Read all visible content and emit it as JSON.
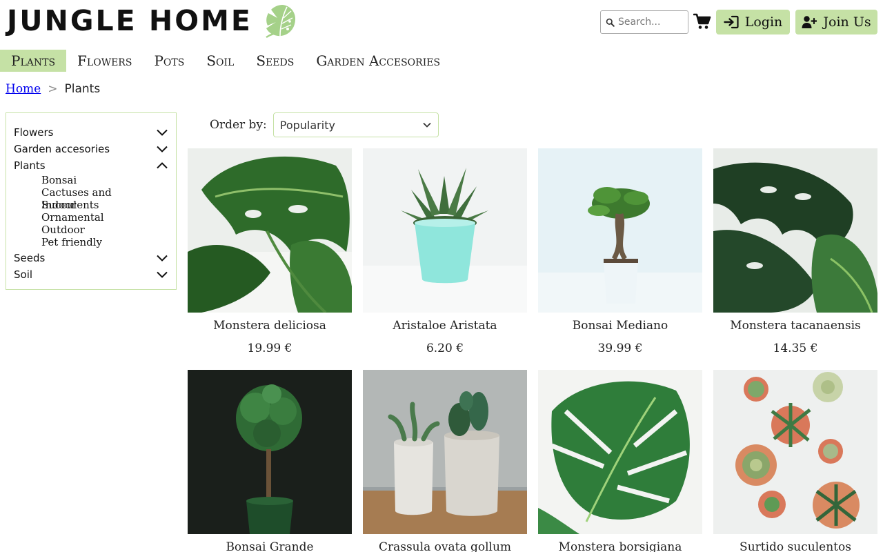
{
  "header": {
    "brand": "JUNGLE HOME",
    "logo_icon": "monstera-leaf-icon",
    "search_placeholder": "Search...",
    "login_label": "Login",
    "join_label": "Join Us",
    "accent_color": "#c5e1a5"
  },
  "nav": {
    "items": [
      {
        "label": "Plants",
        "active": true
      },
      {
        "label": "Flowers",
        "active": false
      },
      {
        "label": "Pots",
        "active": false
      },
      {
        "label": "Soil",
        "active": false
      },
      {
        "label": "Seeds",
        "active": false
      },
      {
        "label": "Garden Accesories",
        "active": false
      }
    ]
  },
  "breadcrumb": {
    "home": "Home",
    "separator": ">",
    "current": "Plants"
  },
  "sidebar": {
    "categories": [
      {
        "label": "Flowers",
        "expanded": false
      },
      {
        "label": "Garden accesories",
        "expanded": false
      },
      {
        "label": "Plants",
        "expanded": true,
        "subcategories": [
          "Bonsai",
          "Cactuses and Succulents",
          "Indoor",
          "Ornamental",
          "Outdoor",
          "Pet friendly"
        ]
      },
      {
        "label": "Seeds",
        "expanded": false
      },
      {
        "label": "Soil",
        "expanded": false
      }
    ]
  },
  "order": {
    "label": "Order by:",
    "selected": "Popularity"
  },
  "products": [
    {
      "name": "Monstera deliciosa",
      "price": "19.99 €"
    },
    {
      "name": "Aristaloe Aristata",
      "price": "6.20 €"
    },
    {
      "name": "Bonsai Mediano",
      "price": "39.99 €"
    },
    {
      "name": "Monstera tacanaensis",
      "price": "14.35 €"
    },
    {
      "name": "Bonsai Grande",
      "price": ""
    },
    {
      "name": "Crassula ovata gollum",
      "price": ""
    },
    {
      "name": "Monstera borsigiana",
      "price": ""
    },
    {
      "name": "Surtido suculentos",
      "price": ""
    }
  ]
}
